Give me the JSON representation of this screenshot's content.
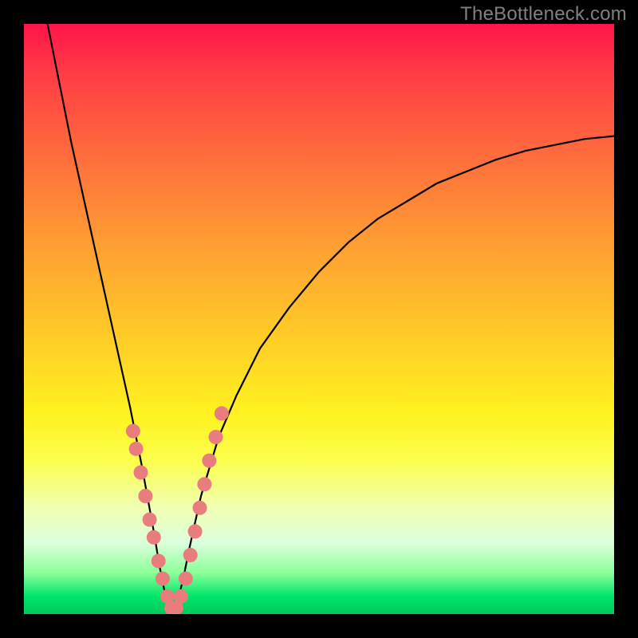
{
  "watermark": {
    "text": "TheBottleneck.com"
  },
  "colors": {
    "frame": "#000000",
    "curve": "#000000",
    "dot_fill": "#e97c7c",
    "dot_stroke": "#d86868",
    "watermark": "#808080",
    "gradient_stops": [
      "#ff144a",
      "#ff3b45",
      "#ff6b3d",
      "#ff9a33",
      "#ffc928",
      "#fff21f",
      "#fbff4d",
      "#f1ffb3",
      "#dbffdc",
      "#8cff99",
      "#00e56a",
      "#00c95a"
    ]
  },
  "chart_data": {
    "type": "line",
    "title": "",
    "xlabel": "",
    "ylabel": "",
    "xlim": [
      0,
      100
    ],
    "ylim": [
      0,
      100
    ],
    "note": "V-shaped bottleneck curve with vertex near x≈25, y≈0. y-axis is visually inverted (0 at bottom → green/optimal, 100 at top → red). Values estimated from pixel positions.",
    "series": [
      {
        "name": "bottleneck-curve",
        "x": [
          4,
          6,
          8,
          10,
          12,
          14,
          16,
          18,
          20,
          22,
          23,
          24,
          25,
          26,
          27,
          28,
          30,
          33,
          36,
          40,
          45,
          50,
          55,
          60,
          65,
          70,
          75,
          80,
          85,
          90,
          95,
          100
        ],
        "y": [
          100,
          90,
          80,
          71,
          62,
          53,
          44,
          35,
          25,
          14,
          8,
          3,
          0,
          2,
          6,
          11,
          20,
          30,
          37,
          45,
          52,
          58,
          63,
          67,
          70,
          73,
          75,
          77,
          78.5,
          79.5,
          80.5,
          81
        ]
      }
    ],
    "highlight_points": {
      "name": "sample-dots",
      "x": [
        18.5,
        19.0,
        19.8,
        20.6,
        21.3,
        22.0,
        22.8,
        23.5,
        24.3,
        25.0,
        25.8,
        26.6,
        27.4,
        28.2,
        29.0,
        29.8,
        30.6,
        31.4,
        32.5,
        33.5
      ],
      "y": [
        31,
        28,
        24,
        20,
        16,
        13,
        9,
        6,
        3,
        1,
        1,
        3,
        6,
        10,
        14,
        18,
        22,
        26,
        30,
        34
      ]
    }
  }
}
